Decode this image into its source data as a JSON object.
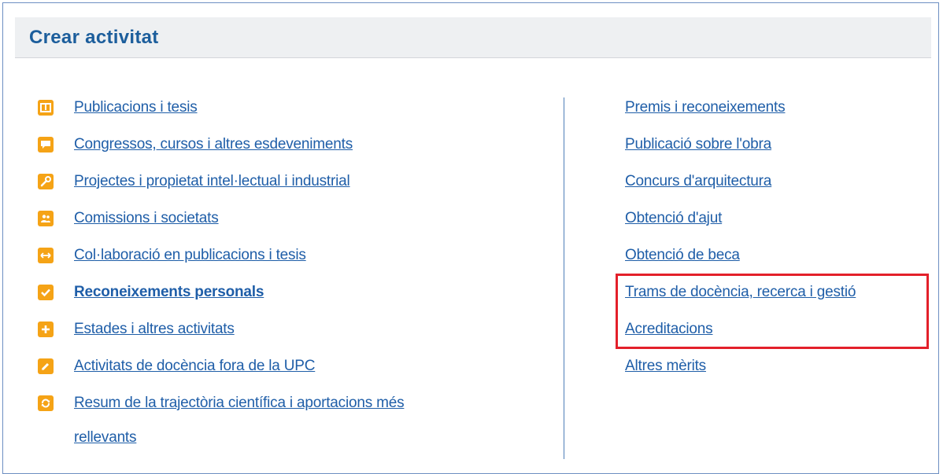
{
  "header": {
    "title": "Crear activitat"
  },
  "left_items": [
    {
      "label": "Publicacions i tesis",
      "icon": "book-icon"
    },
    {
      "label": "Congressos, cursos i altres esdeveniments",
      "icon": "speech-bubble-icon"
    },
    {
      "label": "Projectes i propietat intel·lectual i industrial",
      "icon": "wrench-icon"
    },
    {
      "label": "Comissions i societats",
      "icon": "people-icon"
    },
    {
      "label": "Col·laboració en publicacions i tesis",
      "icon": "arrows-horizontal-icon"
    },
    {
      "label": "Reconeixements personals",
      "icon": "checkmark-icon",
      "selected": true
    },
    {
      "label": "Estades i altres activitats",
      "icon": "plus-icon"
    },
    {
      "label": "Activitats de docència fora de la UPC",
      "icon": "pencil-icon"
    },
    {
      "label": "Resum de la trajectòria científica i aportacions més",
      "label_cont": "rellevants",
      "icon": "cycle-icon"
    }
  ],
  "right_items": [
    {
      "label": "Premis i reconeixements"
    },
    {
      "label": "Publicació sobre l'obra"
    },
    {
      "label": "Concurs d'arquitectura"
    },
    {
      "label": "Obtenció d'ajut"
    },
    {
      "label": "Obtenció de beca"
    },
    {
      "label": "Trams de docència, recerca i gestió",
      "highlighted": true
    },
    {
      "label": "Acreditacions",
      "highlighted": true
    },
    {
      "label": "Altres mèrits"
    }
  ],
  "colors": {
    "accent": "#1c5e9c",
    "link": "#1f5ea8",
    "icon": "#f5a316",
    "highlight": "#e3202a"
  }
}
